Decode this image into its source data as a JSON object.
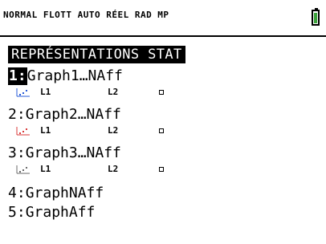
{
  "status_bar": {
    "text": "NORMAL FLOTT AUTO RÉEL RAD MP",
    "battery_icon": "battery-icon",
    "battery_color": "#3aa23a"
  },
  "menu": {
    "title": "REPRÉSENTATIONS STAT",
    "items": [
      {
        "number": "1:",
        "label": "Graph1…NAff",
        "selected": true,
        "sub": {
          "list1": "L1",
          "list2": "L2",
          "plot_color": "#2a5cd8"
        }
      },
      {
        "number": "2:",
        "label": "Graph2…NAff",
        "selected": false,
        "sub": {
          "list1": "L1",
          "list2": "L2",
          "plot_color": "#d83a3a"
        }
      },
      {
        "number": "3:",
        "label": "Graph3…NAff",
        "selected": false,
        "sub": {
          "list1": "L1",
          "list2": "L2",
          "plot_color": "#6a6a6a"
        }
      },
      {
        "number": "4:",
        "label": "GraphNAff",
        "selected": false
      },
      {
        "number": "5:",
        "label": "GraphAff",
        "selected": false
      }
    ]
  }
}
